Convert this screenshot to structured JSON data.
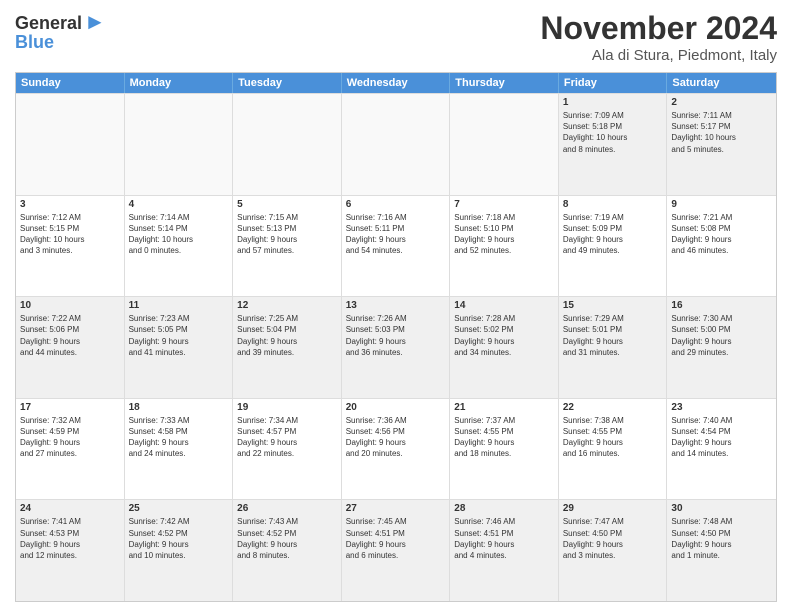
{
  "logo": {
    "line1": "General",
    "line2": "Blue"
  },
  "title": "November 2024",
  "location": "Ala di Stura, Piedmont, Italy",
  "days_of_week": [
    "Sunday",
    "Monday",
    "Tuesday",
    "Wednesday",
    "Thursday",
    "Friday",
    "Saturday"
  ],
  "rows": [
    [
      {
        "day": "",
        "empty": true
      },
      {
        "day": "",
        "empty": true
      },
      {
        "day": "",
        "empty": true
      },
      {
        "day": "",
        "empty": true
      },
      {
        "day": "",
        "empty": true
      },
      {
        "day": "1",
        "info": "Sunrise: 7:09 AM\nSunset: 5:18 PM\nDaylight: 10 hours\nand 8 minutes."
      },
      {
        "day": "2",
        "info": "Sunrise: 7:11 AM\nSunset: 5:17 PM\nDaylight: 10 hours\nand 5 minutes."
      }
    ],
    [
      {
        "day": "3",
        "info": "Sunrise: 7:12 AM\nSunset: 5:15 PM\nDaylight: 10 hours\nand 3 minutes."
      },
      {
        "day": "4",
        "info": "Sunrise: 7:14 AM\nSunset: 5:14 PM\nDaylight: 10 hours\nand 0 minutes."
      },
      {
        "day": "5",
        "info": "Sunrise: 7:15 AM\nSunset: 5:13 PM\nDaylight: 9 hours\nand 57 minutes."
      },
      {
        "day": "6",
        "info": "Sunrise: 7:16 AM\nSunset: 5:11 PM\nDaylight: 9 hours\nand 54 minutes."
      },
      {
        "day": "7",
        "info": "Sunrise: 7:18 AM\nSunset: 5:10 PM\nDaylight: 9 hours\nand 52 minutes."
      },
      {
        "day": "8",
        "info": "Sunrise: 7:19 AM\nSunset: 5:09 PM\nDaylight: 9 hours\nand 49 minutes."
      },
      {
        "day": "9",
        "info": "Sunrise: 7:21 AM\nSunset: 5:08 PM\nDaylight: 9 hours\nand 46 minutes."
      }
    ],
    [
      {
        "day": "10",
        "info": "Sunrise: 7:22 AM\nSunset: 5:06 PM\nDaylight: 9 hours\nand 44 minutes."
      },
      {
        "day": "11",
        "info": "Sunrise: 7:23 AM\nSunset: 5:05 PM\nDaylight: 9 hours\nand 41 minutes."
      },
      {
        "day": "12",
        "info": "Sunrise: 7:25 AM\nSunset: 5:04 PM\nDaylight: 9 hours\nand 39 minutes."
      },
      {
        "day": "13",
        "info": "Sunrise: 7:26 AM\nSunset: 5:03 PM\nDaylight: 9 hours\nand 36 minutes."
      },
      {
        "day": "14",
        "info": "Sunrise: 7:28 AM\nSunset: 5:02 PM\nDaylight: 9 hours\nand 34 minutes."
      },
      {
        "day": "15",
        "info": "Sunrise: 7:29 AM\nSunset: 5:01 PM\nDaylight: 9 hours\nand 31 minutes."
      },
      {
        "day": "16",
        "info": "Sunrise: 7:30 AM\nSunset: 5:00 PM\nDaylight: 9 hours\nand 29 minutes."
      }
    ],
    [
      {
        "day": "17",
        "info": "Sunrise: 7:32 AM\nSunset: 4:59 PM\nDaylight: 9 hours\nand 27 minutes."
      },
      {
        "day": "18",
        "info": "Sunrise: 7:33 AM\nSunset: 4:58 PM\nDaylight: 9 hours\nand 24 minutes."
      },
      {
        "day": "19",
        "info": "Sunrise: 7:34 AM\nSunset: 4:57 PM\nDaylight: 9 hours\nand 22 minutes."
      },
      {
        "day": "20",
        "info": "Sunrise: 7:36 AM\nSunset: 4:56 PM\nDaylight: 9 hours\nand 20 minutes."
      },
      {
        "day": "21",
        "info": "Sunrise: 7:37 AM\nSunset: 4:55 PM\nDaylight: 9 hours\nand 18 minutes."
      },
      {
        "day": "22",
        "info": "Sunrise: 7:38 AM\nSunset: 4:55 PM\nDaylight: 9 hours\nand 16 minutes."
      },
      {
        "day": "23",
        "info": "Sunrise: 7:40 AM\nSunset: 4:54 PM\nDaylight: 9 hours\nand 14 minutes."
      }
    ],
    [
      {
        "day": "24",
        "info": "Sunrise: 7:41 AM\nSunset: 4:53 PM\nDaylight: 9 hours\nand 12 minutes."
      },
      {
        "day": "25",
        "info": "Sunrise: 7:42 AM\nSunset: 4:52 PM\nDaylight: 9 hours\nand 10 minutes."
      },
      {
        "day": "26",
        "info": "Sunrise: 7:43 AM\nSunset: 4:52 PM\nDaylight: 9 hours\nand 8 minutes."
      },
      {
        "day": "27",
        "info": "Sunrise: 7:45 AM\nSunset: 4:51 PM\nDaylight: 9 hours\nand 6 minutes."
      },
      {
        "day": "28",
        "info": "Sunrise: 7:46 AM\nSunset: 4:51 PM\nDaylight: 9 hours\nand 4 minutes."
      },
      {
        "day": "29",
        "info": "Sunrise: 7:47 AM\nSunset: 4:50 PM\nDaylight: 9 hours\nand 3 minutes."
      },
      {
        "day": "30",
        "info": "Sunrise: 7:48 AM\nSunset: 4:50 PM\nDaylight: 9 hours\nand 1 minute."
      }
    ]
  ]
}
